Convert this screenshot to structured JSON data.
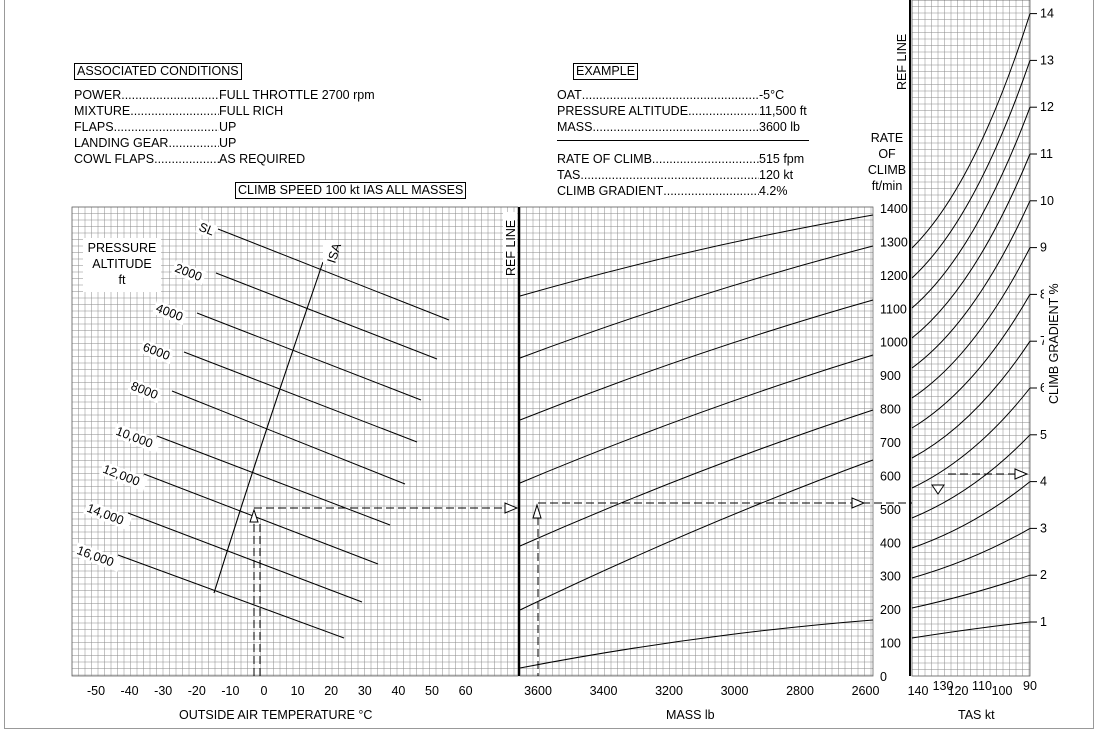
{
  "associated": {
    "title": "ASSOCIATED CONDITIONS",
    "rows": [
      {
        "label": "POWER",
        "value": "FULL THROTTLE  2700 rpm"
      },
      {
        "label": "MIXTURE",
        "value": "FULL RICH"
      },
      {
        "label": "FLAPS",
        "value": "UP"
      },
      {
        "label": "LANDING GEAR",
        "value": "UP"
      },
      {
        "label": "COWL FLAPS",
        "value": "AS REQUIRED"
      }
    ],
    "climb_speed": "CLIMB SPEED  100 kt  IAS   ALL MASSES"
  },
  "example": {
    "title": "EXAMPLE",
    "rows": [
      {
        "label": "OAT",
        "value": "-5°C"
      },
      {
        "label": "PRESSURE ALTITUDE",
        "value": "11,500 ft"
      },
      {
        "label": "MASS",
        "value": "3600 lb"
      }
    ],
    "results": [
      {
        "label": "RATE OF CLIMB",
        "value": "515 fpm"
      },
      {
        "label": "TAS",
        "value": "120 kt"
      },
      {
        "label": "CLIMB GRADIENT",
        "value": "4.2%"
      }
    ]
  },
  "panel1": {
    "title_lines": [
      "PRESSURE",
      "ALTITUDE",
      "ft"
    ],
    "xlabel": "OUTSIDE AIR TEMPERATURE   °C",
    "ticks": [
      "-50",
      "-40",
      "-30",
      "-20",
      "-10",
      "0",
      "10",
      "20",
      "30",
      "40",
      "50",
      "60"
    ],
    "ref_line": "REF LINE",
    "isa_label": "ISA",
    "altitude_labels": [
      "SL",
      "2000",
      "4000",
      "6000",
      "8000",
      "10,000",
      "12,000",
      "14,000",
      "16,000"
    ]
  },
  "panel2": {
    "xlabel": "MASS lb",
    "ticks": [
      "3600",
      "3400",
      "3200",
      "3000",
      "2800",
      "2600"
    ]
  },
  "panel3": {
    "roc_label_lines": [
      "RATE",
      "OF",
      "CLIMB",
      "ft/min"
    ],
    "roc_ticks": [
      "1400",
      "1300",
      "1200",
      "1100",
      "1000",
      "900",
      "800",
      "700",
      "600",
      "500",
      "400",
      "300",
      "200",
      "100",
      "0"
    ],
    "ref_line": "REF LINE",
    "xlabel": "TAS kt",
    "tas_ticks": [
      "140",
      "130",
      "120",
      "110",
      "100",
      "90"
    ],
    "gradient_label": "CLIMB GRADIENT  %",
    "gradient_ticks": [
      "1",
      "2",
      "3",
      "4",
      "5",
      "6",
      "7",
      "8",
      "9",
      "10",
      "11",
      "12",
      "13",
      "14"
    ]
  },
  "chart_data": [
    {
      "type": "line",
      "title": "",
      "xlabel": "OUTSIDE AIR TEMPERATURE   °C",
      "ylabel": "PRESSURE ALTITUDE ft",
      "xlim": [
        -55,
        65
      ],
      "series": [
        {
          "name": "SL",
          "x": [
            -20,
            50
          ],
          "y": [
            0,
            0
          ]
        },
        {
          "name": "2000",
          "x": [
            -25,
            47
          ],
          "y": [
            2000,
            2000
          ]
        },
        {
          "name": "4000",
          "x": [
            -30,
            43
          ],
          "y": [
            4000,
            4000
          ]
        },
        {
          "name": "6000",
          "x": [
            -35,
            40
          ],
          "y": [
            6000,
            6000
          ]
        },
        {
          "name": "8000",
          "x": [
            -40,
            36
          ],
          "y": [
            8000,
            8000
          ]
        },
        {
          "name": "10,000",
          "x": [
            -45,
            32
          ],
          "y": [
            10000,
            10000
          ]
        },
        {
          "name": "12,000",
          "x": [
            -50,
            28
          ],
          "y": [
            12000,
            12000
          ]
        },
        {
          "name": "14,000",
          "x": [
            -52,
            24
          ],
          "y": [
            14000,
            14000
          ]
        },
        {
          "name": "16,000",
          "x": [
            -53,
            20
          ],
          "y": [
            16000,
            16000
          ]
        },
        {
          "name": "ISA",
          "x": [
            15,
            -17
          ],
          "y": [
            0,
            16000
          ]
        }
      ],
      "example": {
        "oat": -5,
        "pressure_altitude": 11500
      }
    },
    {
      "type": "line",
      "title": "",
      "xlabel": "MASS lb",
      "x_reversed": true,
      "xlim": [
        3700,
        2600
      ]
    },
    {
      "type": "line",
      "title": "",
      "xlabel": "TAS kt",
      "ylabel": "RATE OF CLIMB ft/min",
      "ylim": [
        0,
        1400
      ],
      "y2label": "CLIMB GRADIENT  %",
      "y2lim": [
        1,
        14
      ],
      "example": {
        "rate_of_climb": 515,
        "tas": 120,
        "climb_gradient": 4.2
      }
    }
  ]
}
